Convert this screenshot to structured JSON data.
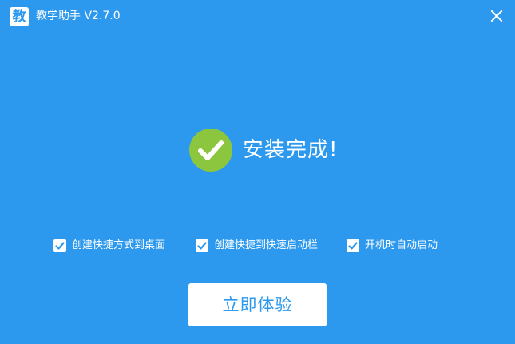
{
  "window": {
    "logo_char": "教",
    "title": "教学助手 V2.7.0",
    "close_icon": "close-icon"
  },
  "main": {
    "success_icon": "check-circle-icon",
    "success_message": "安装完成!"
  },
  "options": [
    {
      "label": "创建快捷方式到桌面",
      "checked": true
    },
    {
      "label": "创建快捷到快速启动栏",
      "checked": true
    },
    {
      "label": "开机时自动启动",
      "checked": true
    }
  ],
  "actions": {
    "start_label": "立即体验"
  },
  "colors": {
    "background": "#2d99ee",
    "check_green": "#8cc63e",
    "text": "#ffffff",
    "button_text": "#2d99ee"
  }
}
